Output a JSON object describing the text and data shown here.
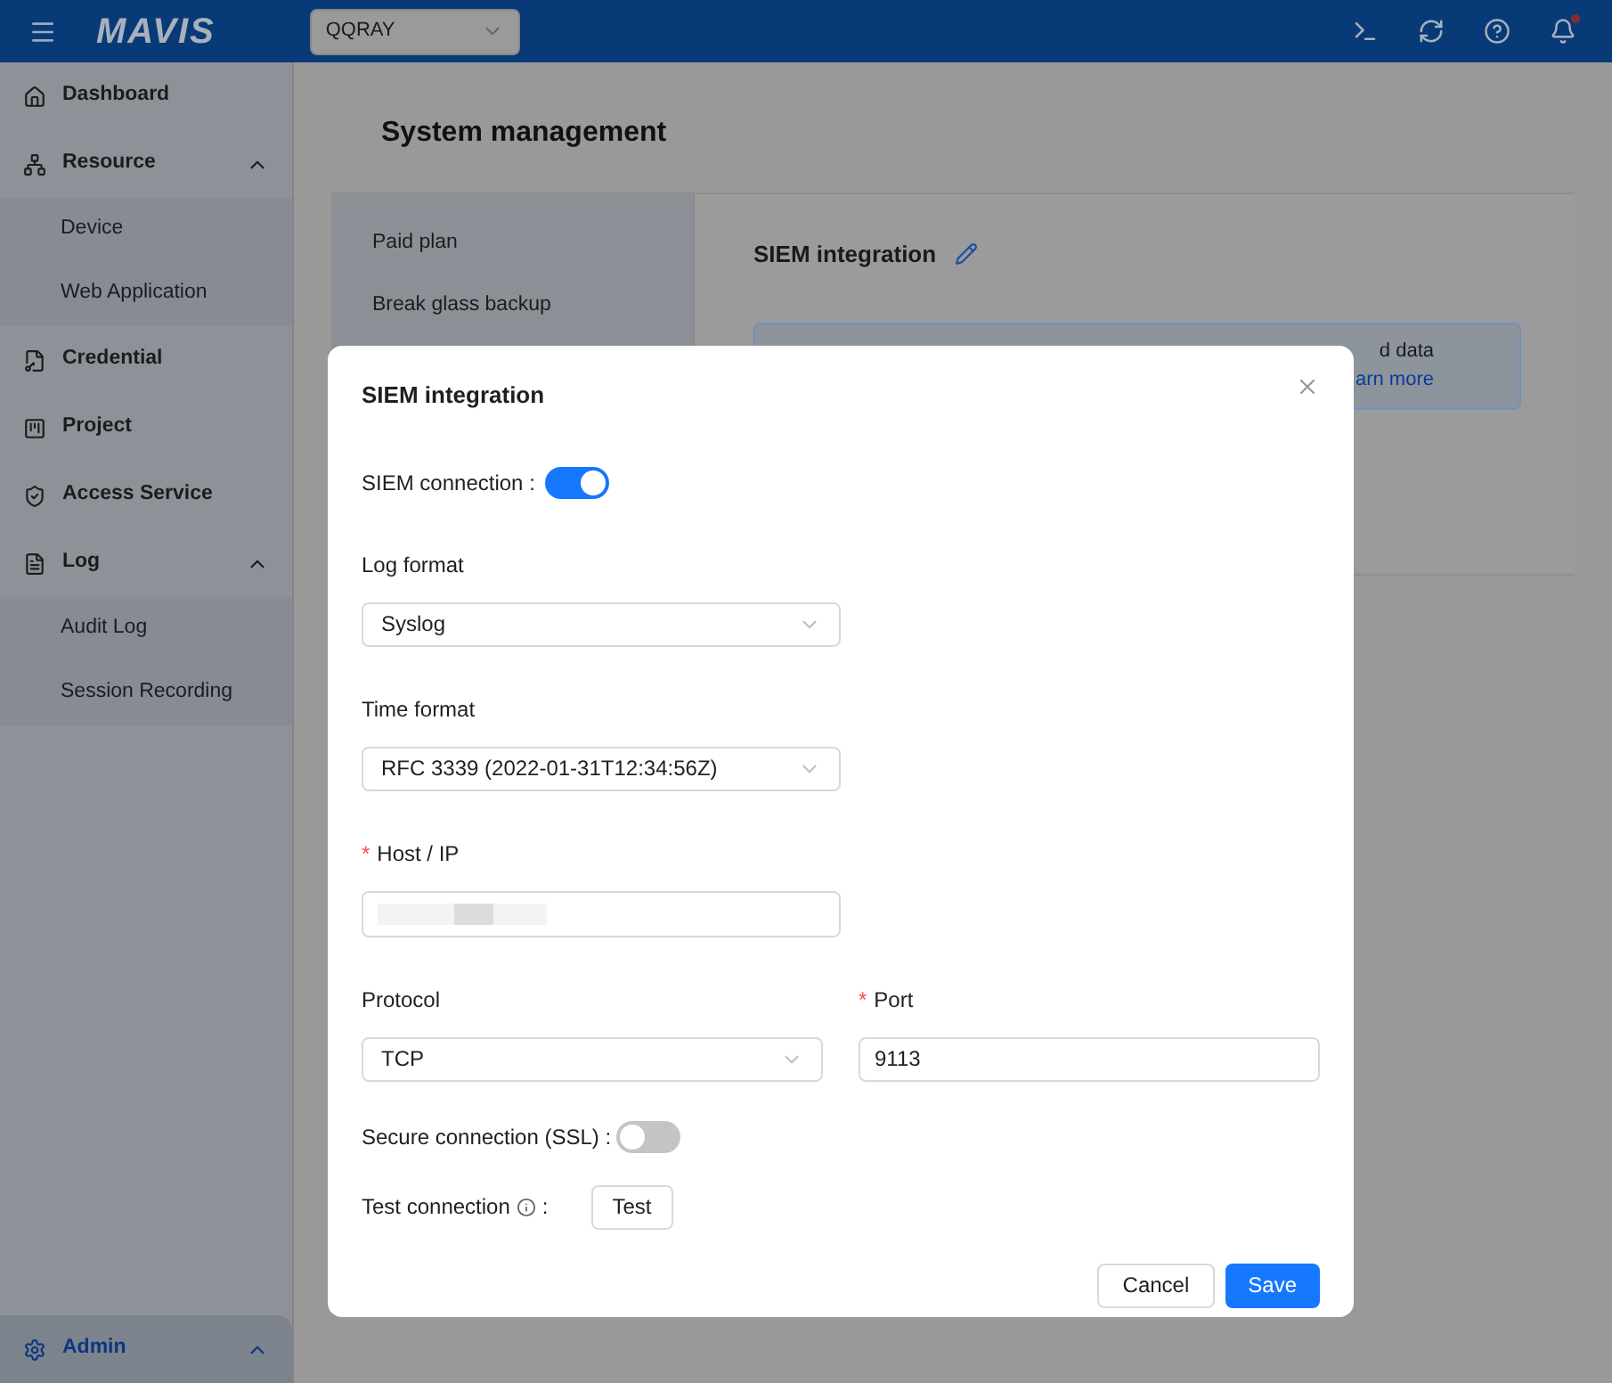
{
  "topbar": {
    "logo": "MAVIS",
    "workspace": "QQRAY"
  },
  "sidebar": {
    "items": [
      {
        "label": "Dashboard",
        "selected": false
      },
      {
        "label": "Resource",
        "expanded": true,
        "selected": false,
        "children": [
          {
            "label": "Device",
            "selected": false
          },
          {
            "label": "Web Application",
            "selected": false
          }
        ]
      },
      {
        "label": "Credential",
        "selected": false
      },
      {
        "label": "Project",
        "selected": false
      },
      {
        "label": "Access Service",
        "selected": false
      },
      {
        "label": "Log",
        "expanded": true,
        "selected": false,
        "children": [
          {
            "label": "Audit Log",
            "selected": false
          },
          {
            "label": "Session Recording",
            "selected": false
          }
        ]
      },
      {
        "label": "Admin",
        "expanded": true,
        "selected": true
      }
    ]
  },
  "page": {
    "title": "System management",
    "menu": [
      {
        "label": "Paid plan",
        "selected": false
      },
      {
        "label": "Break glass backup",
        "selected": false
      }
    ],
    "section_title": "SIEM integration",
    "notice": {
      "text": "d data",
      "link": "arn more"
    }
  },
  "dialog": {
    "title": "SIEM integration",
    "siem_connection": {
      "label": "SIEM connection",
      "separator": ":",
      "on": true
    },
    "log_format": {
      "label": "Log format",
      "value": "Syslog"
    },
    "time_format": {
      "label": "Time format",
      "value": "RFC 3339 (2022-01-31T12:34:56Z)"
    },
    "host": {
      "label": "Host / IP",
      "required_mark": "*"
    },
    "protocol": {
      "label": "Protocol",
      "value": "TCP"
    },
    "port": {
      "label": "Port",
      "value": "9113",
      "required_mark": "*"
    },
    "ssl": {
      "label": "Secure connection (SSL)",
      "separator": ":",
      "on": false
    },
    "test": {
      "label": "Test connection",
      "separator": ":",
      "button": "Test"
    },
    "buttons": {
      "cancel": "Cancel",
      "save": "Save"
    }
  }
}
